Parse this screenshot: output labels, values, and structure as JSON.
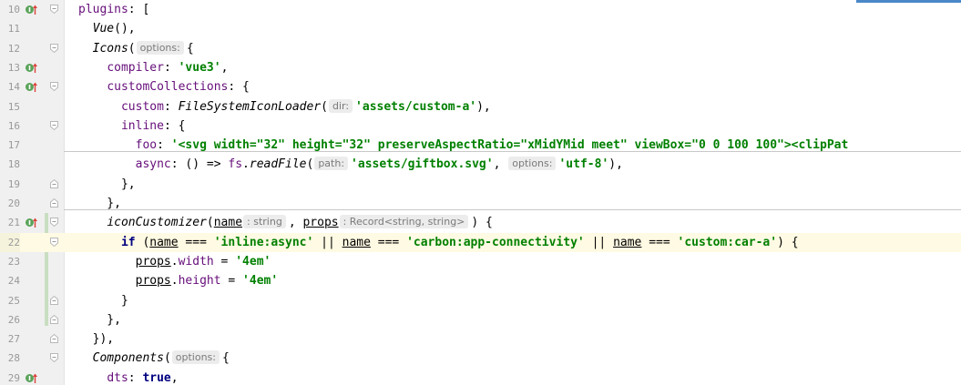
{
  "editor": {
    "colors": {
      "keyword": "#000080",
      "string": "#008000",
      "property": "#660e7a",
      "gutter_bg": "#f0f0f0",
      "current_line": "#fffae3"
    },
    "lines": [
      {
        "num": "10",
        "impl": true,
        "fold": "start",
        "tokens": [
          {
            "t": "prop",
            "v": "plugins"
          },
          {
            "t": "p",
            "v": ": ["
          }
        ]
      },
      {
        "num": "11",
        "impl": false,
        "fold": "",
        "tokens": [
          {
            "t": "p",
            "v": "  "
          },
          {
            "t": "fn",
            "v": "Vue"
          },
          {
            "t": "p",
            "v": "(),"
          }
        ]
      },
      {
        "num": "12",
        "impl": false,
        "fold": "start",
        "tokens": [
          {
            "t": "p",
            "v": "  "
          },
          {
            "t": "fn",
            "v": "Icons"
          },
          {
            "t": "p",
            "v": "("
          },
          {
            "t": "hint",
            "v": "options:"
          },
          {
            "t": "p",
            "v": "{"
          }
        ]
      },
      {
        "num": "13",
        "impl": true,
        "fold": "",
        "tokens": [
          {
            "t": "p",
            "v": "    "
          },
          {
            "t": "prop",
            "v": "compiler"
          },
          {
            "t": "p",
            "v": ": "
          },
          {
            "t": "str",
            "v": "'vue3'"
          },
          {
            "t": "p",
            "v": ","
          }
        ]
      },
      {
        "num": "14",
        "impl": true,
        "fold": "start",
        "tokens": [
          {
            "t": "p",
            "v": "    "
          },
          {
            "t": "prop",
            "v": "customCollections"
          },
          {
            "t": "p",
            "v": ": {"
          }
        ]
      },
      {
        "num": "15",
        "impl": false,
        "fold": "",
        "tokens": [
          {
            "t": "p",
            "v": "      "
          },
          {
            "t": "prop",
            "v": "custom"
          },
          {
            "t": "p",
            "v": ": "
          },
          {
            "t": "fn",
            "v": "FileSystemIconLoader"
          },
          {
            "t": "p",
            "v": "("
          },
          {
            "t": "hint",
            "v": "dir:"
          },
          {
            "t": "str",
            "v": "'assets/custom-a'"
          },
          {
            "t": "p",
            "v": "),"
          }
        ]
      },
      {
        "num": "16",
        "impl": false,
        "fold": "start",
        "tokens": [
          {
            "t": "p",
            "v": "      "
          },
          {
            "t": "prop",
            "v": "inline"
          },
          {
            "t": "p",
            "v": ": {"
          }
        ]
      },
      {
        "num": "17",
        "impl": false,
        "fold": "",
        "tokens": [
          {
            "t": "p",
            "v": "        "
          },
          {
            "t": "prop",
            "v": "foo"
          },
          {
            "t": "p",
            "v": ": "
          },
          {
            "t": "str",
            "v": "'<svg width=\"32\" height=\"32\" preserveAspectRatio=\"xMidYMid meet\" viewBox=\"0 0 100 100\"><clipPat"
          }
        ]
      },
      {
        "num": "18",
        "impl": false,
        "fold": "",
        "tokens": [
          {
            "t": "p",
            "v": "        "
          },
          {
            "t": "prop",
            "v": "async"
          },
          {
            "t": "p",
            "v": ": () => "
          },
          {
            "t": "prop",
            "v": "fs"
          },
          {
            "t": "p",
            "v": "."
          },
          {
            "t": "fn",
            "v": "readFile"
          },
          {
            "t": "p",
            "v": "("
          },
          {
            "t": "hint",
            "v": "path:"
          },
          {
            "t": "str",
            "v": "'assets/giftbox.svg'"
          },
          {
            "t": "p",
            "v": ", "
          },
          {
            "t": "hint",
            "v": "options:"
          },
          {
            "t": "str",
            "v": "'utf-8'"
          },
          {
            "t": "p",
            "v": "),"
          }
        ]
      },
      {
        "num": "19",
        "impl": false,
        "fold": "end",
        "tokens": [
          {
            "t": "p",
            "v": "      },"
          }
        ]
      },
      {
        "num": "20",
        "impl": false,
        "fold": "end",
        "tokens": [
          {
            "t": "p",
            "v": "    },"
          }
        ]
      },
      {
        "num": "21",
        "impl": true,
        "fold": "start",
        "tokens": [
          {
            "t": "p",
            "v": "    "
          },
          {
            "t": "fn",
            "v": "iconCustomizer"
          },
          {
            "t": "p",
            "v": "("
          },
          {
            "t": "param",
            "v": "name"
          },
          {
            "t": "hint",
            "v": ": string"
          },
          {
            "t": "p",
            "v": ", "
          },
          {
            "t": "param",
            "v": "props"
          },
          {
            "t": "hint",
            "v": ": Record<string, string>"
          },
          {
            "t": "p",
            "v": ") {"
          }
        ]
      },
      {
        "num": "22",
        "impl": false,
        "fold": "start",
        "tokens": [
          {
            "t": "p",
            "v": "      "
          },
          {
            "t": "kw",
            "v": "if"
          },
          {
            "t": "p",
            "v": " ("
          },
          {
            "t": "param",
            "v": "name"
          },
          {
            "t": "p",
            "v": " === "
          },
          {
            "t": "str",
            "v": "'inline:async'"
          },
          {
            "t": "p",
            "v": " || "
          },
          {
            "t": "param",
            "v": "name"
          },
          {
            "t": "p",
            "v": " === "
          },
          {
            "t": "str",
            "v": "'carbon:app-connectivity'"
          },
          {
            "t": "p",
            "v": " || "
          },
          {
            "t": "param",
            "v": "name"
          },
          {
            "t": "p",
            "v": " === "
          },
          {
            "t": "str",
            "v": "'custom:car-a'"
          },
          {
            "t": "p",
            "v": ") {"
          }
        ]
      },
      {
        "num": "23",
        "impl": false,
        "fold": "",
        "tokens": [
          {
            "t": "p",
            "v": "        "
          },
          {
            "t": "param",
            "v": "props"
          },
          {
            "t": "p",
            "v": "."
          },
          {
            "t": "prop",
            "v": "width"
          },
          {
            "t": "p",
            "v": " = "
          },
          {
            "t": "str",
            "v": "'4em'"
          }
        ]
      },
      {
        "num": "24",
        "impl": false,
        "fold": "",
        "tokens": [
          {
            "t": "p",
            "v": "        "
          },
          {
            "t": "param",
            "v": "props"
          },
          {
            "t": "p",
            "v": "."
          },
          {
            "t": "prop",
            "v": "height"
          },
          {
            "t": "p",
            "v": " = "
          },
          {
            "t": "str",
            "v": "'4em'"
          }
        ]
      },
      {
        "num": "25",
        "impl": false,
        "fold": "end",
        "tokens": [
          {
            "t": "p",
            "v": "      }"
          }
        ]
      },
      {
        "num": "26",
        "impl": false,
        "fold": "end",
        "tokens": [
          {
            "t": "p",
            "v": "    },"
          }
        ]
      },
      {
        "num": "27",
        "impl": false,
        "fold": "end",
        "tokens": [
          {
            "t": "p",
            "v": "  }),"
          }
        ]
      },
      {
        "num": "28",
        "impl": false,
        "fold": "start",
        "tokens": [
          {
            "t": "p",
            "v": "  "
          },
          {
            "t": "fn",
            "v": "Components"
          },
          {
            "t": "p",
            "v": "("
          },
          {
            "t": "hint",
            "v": "options:"
          },
          {
            "t": "p",
            "v": "{"
          }
        ]
      },
      {
        "num": "29",
        "impl": true,
        "fold": "",
        "tokens": [
          {
            "t": "p",
            "v": "    "
          },
          {
            "t": "prop",
            "v": "dts"
          },
          {
            "t": "p",
            "v": ": "
          },
          {
            "t": "kw",
            "v": "true"
          },
          {
            "t": "p",
            "v": ","
          }
        ]
      }
    ],
    "current_line": "22"
  }
}
